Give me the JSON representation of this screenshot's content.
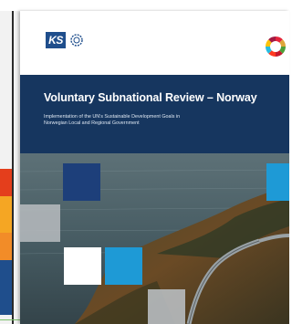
{
  "cover": {
    "logo_text": "KS",
    "title": "Voluntary Subnational Review – Norway",
    "subtitle_line1": "Implementation of the UN’s Sustainable Development Goals in",
    "subtitle_line2": "Norwegian Local and Regional Government"
  },
  "colors": {
    "navy": "#16365f",
    "brand_blue": "#1f4e8c",
    "tile_dark_blue": "#1d3f7a",
    "tile_light_blue": "#1e9ad6",
    "tile_white": "#ffffff",
    "tile_grey": "#b8bcc0"
  },
  "icons": {
    "logo_ring": "logo-ring-icon",
    "sdg_wheel": "sdg-wheel-icon"
  }
}
